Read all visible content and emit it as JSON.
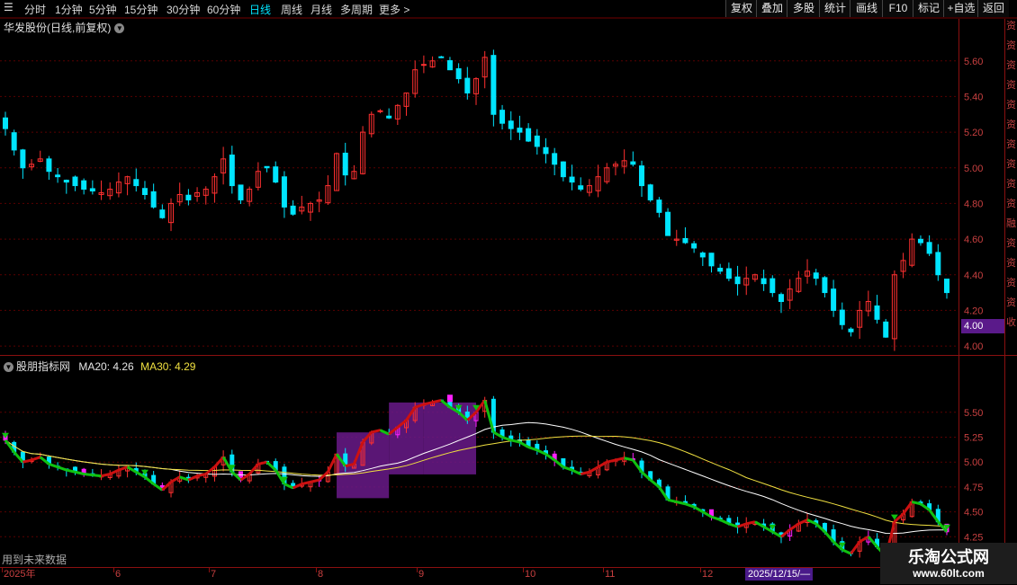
{
  "toolbar": {
    "periods": [
      {
        "label": "分时",
        "active": false
      },
      {
        "label": "1分钟",
        "active": false
      },
      {
        "label": "5分钟",
        "active": false
      },
      {
        "label": "15分钟",
        "active": false
      },
      {
        "label": "30分钟",
        "active": false
      },
      {
        "label": "60分钟",
        "active": false
      },
      {
        "label": "日线",
        "active": true
      },
      {
        "label": "周线",
        "active": false
      },
      {
        "label": "月线",
        "active": false
      },
      {
        "label": "多周期",
        "active": false
      },
      {
        "label": "更多 >",
        "active": false
      }
    ],
    "buttons": [
      "复权",
      "叠加",
      "多股",
      "统计",
      "画线",
      "F10",
      "标记",
      "+自选",
      "返回"
    ]
  },
  "main_chart": {
    "title": "华发股份(日线,前复权)",
    "price_ticks": [
      "5.60",
      "5.40",
      "5.20",
      "5.00",
      "4.80",
      "4.60",
      "4.40",
      "4.20",
      "4.00"
    ],
    "current_price_label": "4.00",
    "side_text": [
      "资",
      "资",
      "资",
      "资",
      "资",
      "资",
      "资",
      "资",
      "资",
      "资",
      "融",
      "资",
      "资",
      "资",
      "资",
      "收"
    ]
  },
  "indicator": {
    "name": "股朋指标网",
    "ma20_label": "MA20: 4.26",
    "ma30_label": "MA30: 4.29",
    "ticks": [
      "5.50",
      "5.25",
      "5.00",
      "4.75",
      "4.50",
      "4.25"
    ],
    "future_note": "用到未来数据"
  },
  "date_axis": {
    "labels": [
      "2025年",
      "6",
      "7",
      "8",
      "9",
      "10",
      "11",
      "12"
    ],
    "cursor_label": "2025/12/15/—"
  },
  "watermark": {
    "title": "乐淘公式网",
    "url": "www.60lt.com"
  },
  "colors": {
    "up": "#ff3030",
    "down": "#00e5ff",
    "grid": "#5a0000",
    "ma20": "#ffffff",
    "ma30": "#f0e040",
    "ind_up": "#cc1010",
    "ind_down": "#10c010",
    "magenta": "#ff20ff",
    "purple": "#6a1a8a"
  },
  "chart_data": {
    "type": "candlestick",
    "ylim": [
      3.95,
      5.75
    ],
    "close_series": [
      5.22,
      5.1,
      5.0,
      5.02,
      5.05,
      4.98,
      4.95,
      4.92,
      4.9,
      4.88,
      4.87,
      4.86,
      4.88,
      4.92,
      4.95,
      4.9,
      4.85,
      4.78,
      4.72,
      4.8,
      4.85,
      4.82,
      4.86,
      4.88,
      4.95,
      5.05,
      4.9,
      4.82,
      4.88,
      4.98,
      5.0,
      4.92,
      4.78,
      4.74,
      4.78,
      4.8,
      4.82,
      4.9,
      5.08,
      4.96,
      4.98,
      5.2,
      5.3,
      5.32,
      5.28,
      5.35,
      5.42,
      5.55,
      5.58,
      5.6,
      5.62,
      5.55,
      5.5,
      5.42,
      5.5,
      5.62,
      5.3,
      5.25,
      5.22,
      5.2,
      5.15,
      5.12,
      5.08,
      5.02,
      4.95,
      4.92,
      4.88,
      4.9,
      4.95,
      5.0,
      5.02,
      5.04,
      5.02,
      4.9,
      4.82,
      4.75,
      4.62,
      4.6,
      4.58,
      4.55,
      4.5,
      4.45,
      4.42,
      4.38,
      4.35,
      4.38,
      4.4,
      4.35,
      4.3,
      4.25,
      4.32,
      4.38,
      4.42,
      4.38,
      4.3,
      4.2,
      4.12,
      4.08,
      4.2,
      4.25,
      4.15,
      4.05,
      4.4,
      4.48,
      4.6,
      4.58,
      4.52,
      4.4,
      4.3
    ]
  }
}
